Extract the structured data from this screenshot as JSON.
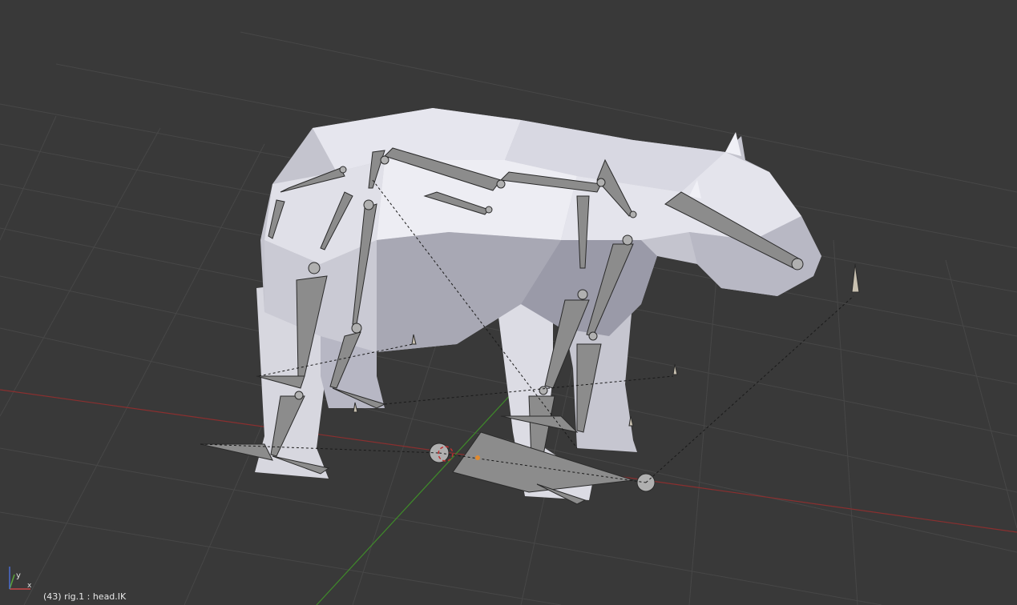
{
  "viewport": {
    "status_text": "(43) rig.1 : head.IK",
    "object_name": "bear",
    "armature_name": "rig.1",
    "active_bone": "head.IK",
    "current_frame": 43,
    "background_color": "#393939",
    "grid_color": "#444444",
    "x_axis_color": "#8a2f2f",
    "y_axis_color": "#3f8a2a"
  },
  "orientation_gizmo": {
    "x_label": "x",
    "y_label": "y",
    "z_label": "z",
    "x_color": "#c74848",
    "y_color": "#5aa63c",
    "z_color": "#4b6ccf"
  }
}
